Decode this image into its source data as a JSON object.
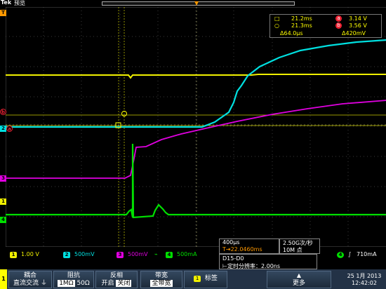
{
  "header": {
    "logo": "Tek",
    "mode": "预览"
  },
  "cursor_readout": {
    "row1": {
      "time": "21.2ms",
      "id": "a",
      "volt": "3.14 V"
    },
    "row2": {
      "time": "21.3ms",
      "id": "b",
      "volt": "3.56 V"
    },
    "row3": {
      "dtime": "Δ64.0µs",
      "dvolt": "Δ420mV"
    }
  },
  "markers": {
    "trig_top": "T",
    "cursor_b": "b",
    "ch2": "2",
    "ch3": "3",
    "ch1": "1",
    "ch4": "4",
    "cursor_a": "a"
  },
  "channels": [
    {
      "num": "1",
      "scale": "1.00 V",
      "color": "#f0f000"
    },
    {
      "num": "2",
      "scale": "500mV",
      "color": "#00e0e0"
    },
    {
      "num": "3",
      "scale": "500mV",
      "color": "#e000e0"
    },
    {
      "num": "4",
      "scale": "500mA",
      "color": "#00e000"
    }
  ],
  "timebase": {
    "scale": "400µs",
    "delay": "T⇥22.0460ms",
    "sample_rate": "2.50G次/秒",
    "record_length": "10M 点"
  },
  "trigger": {
    "channel": "4",
    "slope": "∫",
    "level": "710mA"
  },
  "status": {
    "line1": "D15-D0",
    "line2": "⊢定时分辨率：2.00ns"
  },
  "menu": {
    "side_tab": "1",
    "coupling": {
      "title": "耦合",
      "opt1": "直流",
      "opt2": "交流",
      "opt3": "⏚"
    },
    "impedance": {
      "title": "阻抗",
      "opt1": "1MΩ",
      "opt2": "50Ω"
    },
    "invert": {
      "title": "反相",
      "opt1": "开启",
      "opt2": "关闭"
    },
    "bandwidth": {
      "title": "带宽",
      "opt1": "全带宽"
    },
    "label": {
      "badge": "1",
      "title": "标签"
    },
    "more": {
      "title": "更多",
      "arrow": "▲"
    }
  },
  "datetime": {
    "date": "25 1月 2013",
    "time": "12:42:02"
  },
  "colors": {
    "ch1": "#f0f000",
    "ch2": "#00e0e0",
    "ch3": "#e000e0",
    "ch4": "#00e000",
    "cursor": "#ff0",
    "background": "#000000",
    "menu": "#233246"
  }
}
